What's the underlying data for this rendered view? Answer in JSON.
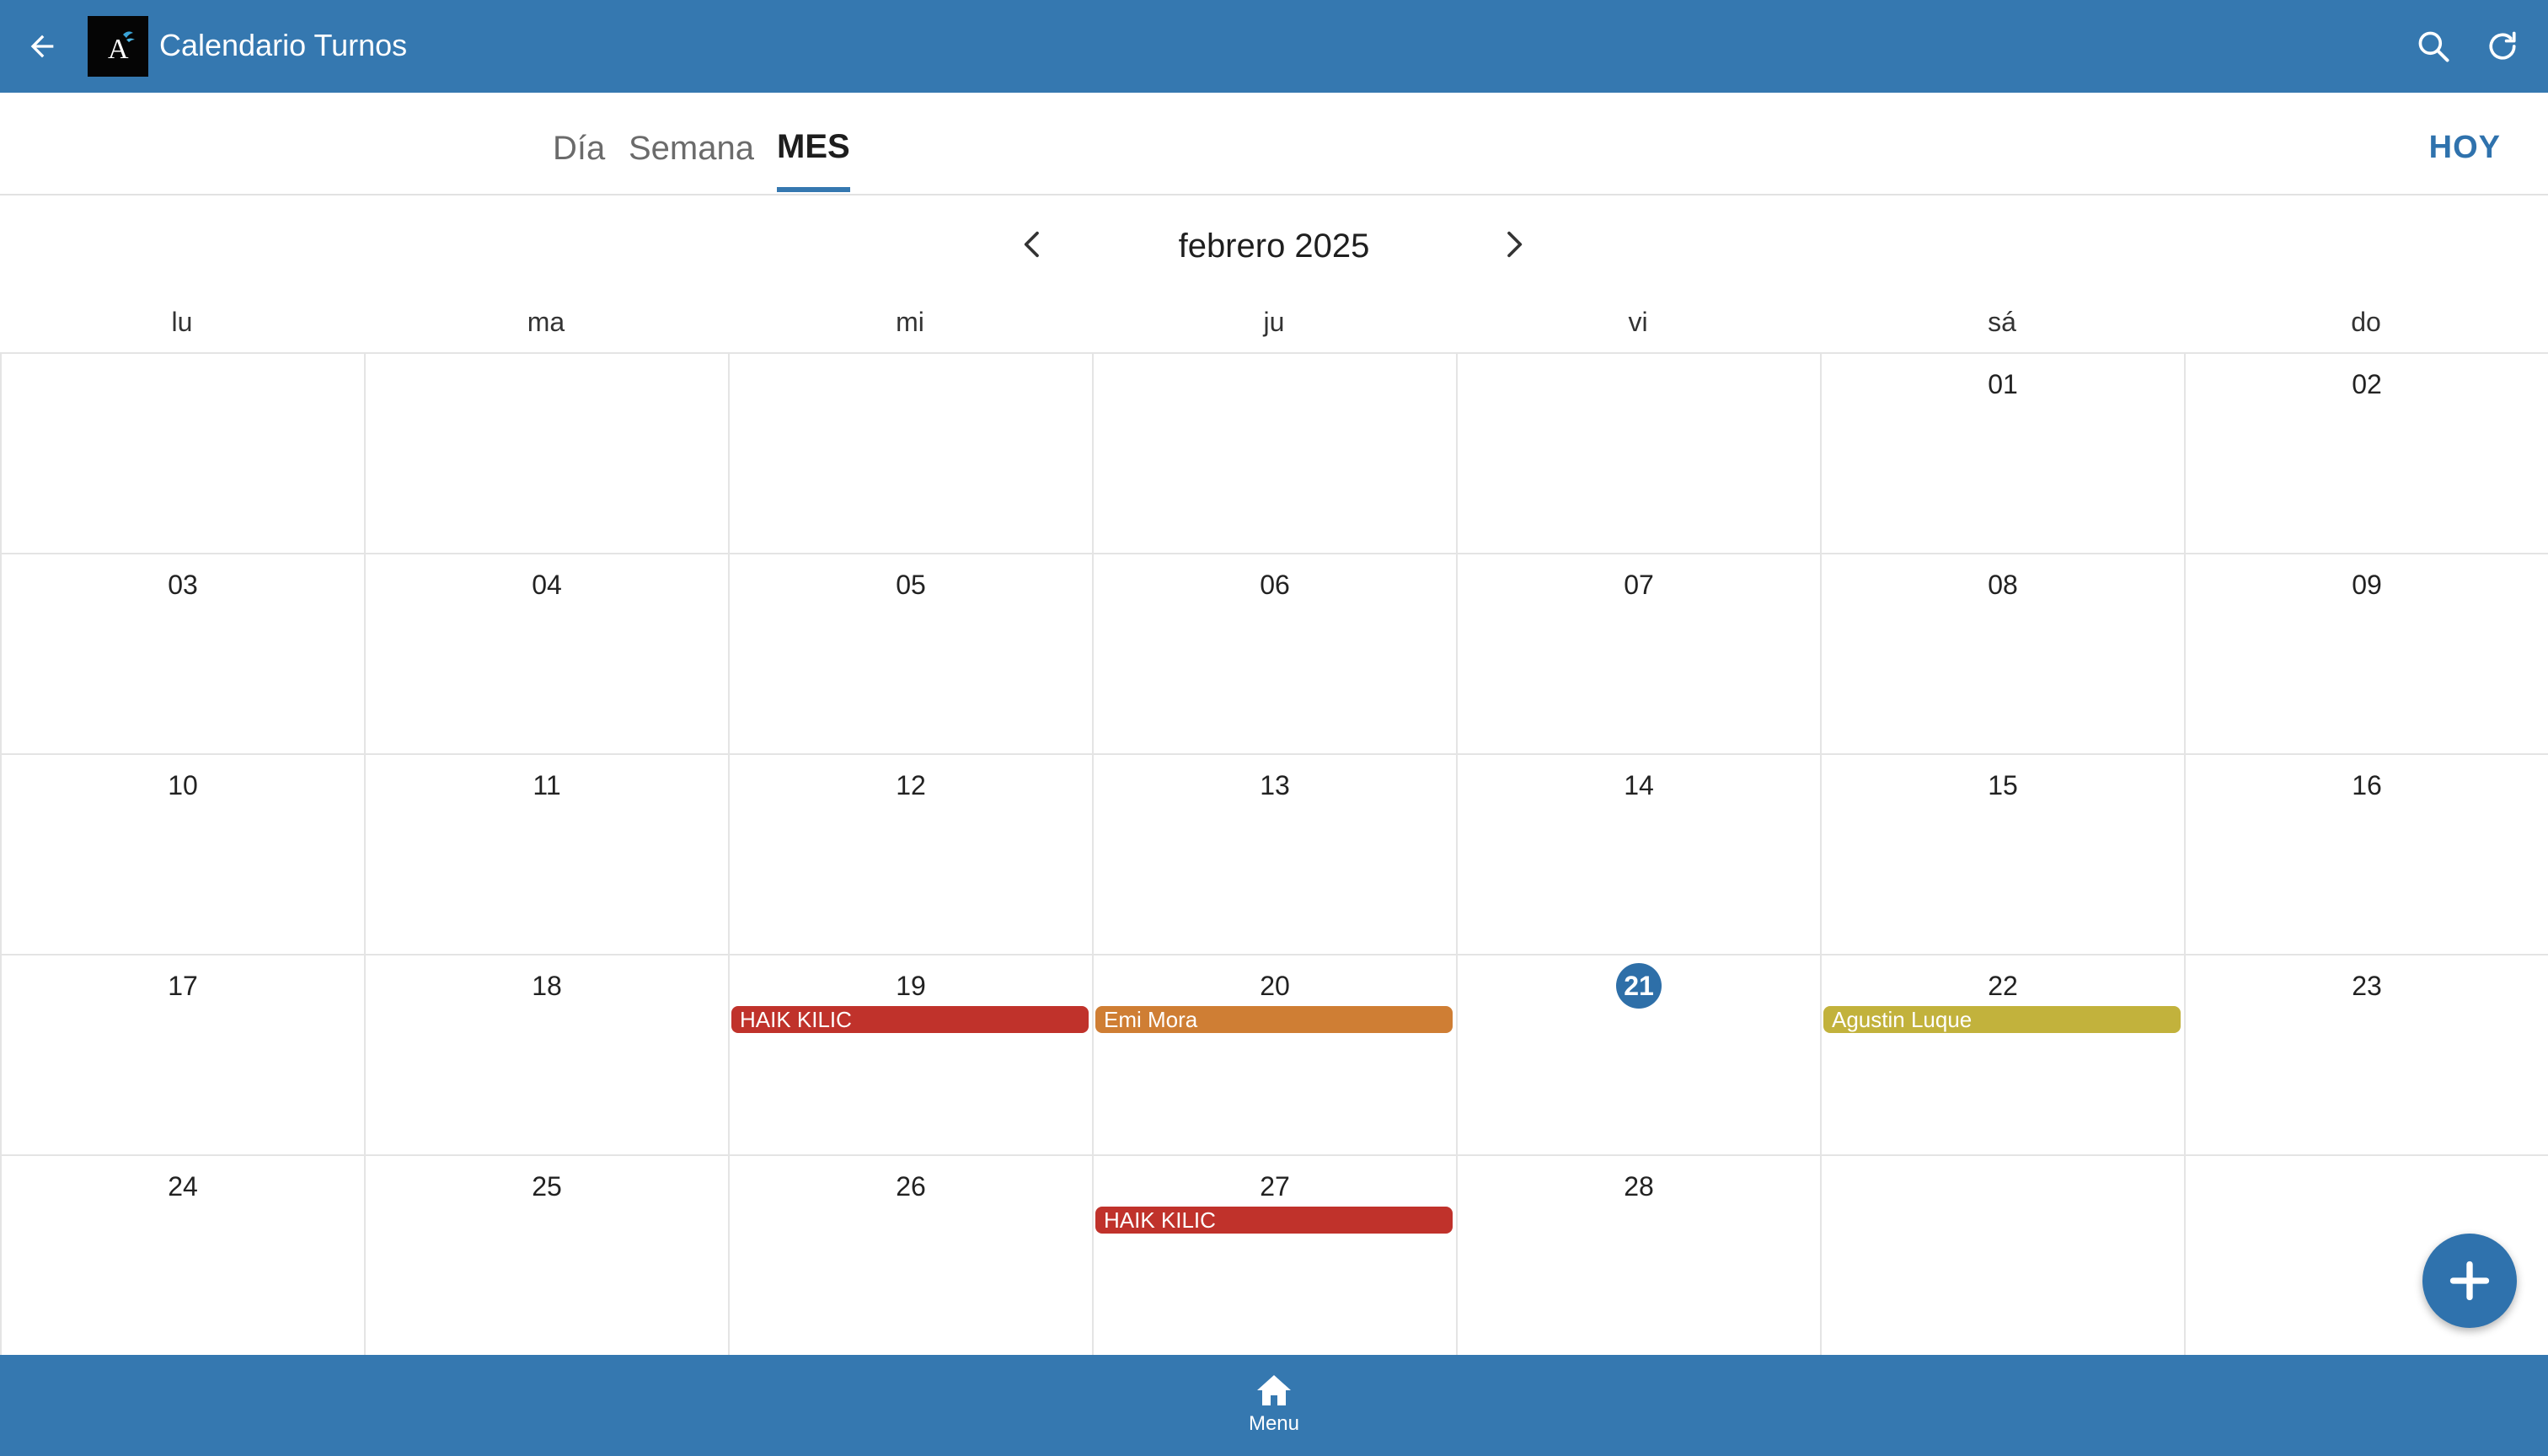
{
  "app": {
    "title": "Calendario Turnos",
    "logo_text": "A"
  },
  "tabs": [
    {
      "label": "Día",
      "active": false
    },
    {
      "label": "Semana",
      "active": false
    },
    {
      "label": "MES",
      "active": true
    }
  ],
  "today_button": "HOY",
  "month_label": "febrero 2025",
  "weekdays": [
    "lu",
    "ma",
    "mi",
    "ju",
    "vi",
    "sá",
    "do"
  ],
  "weeks": [
    [
      "",
      "",
      "",
      "",
      "",
      "01",
      "02"
    ],
    [
      "03",
      "04",
      "05",
      "06",
      "07",
      "08",
      "09"
    ],
    [
      "10",
      "11",
      "12",
      "13",
      "14",
      "15",
      "16"
    ],
    [
      "17",
      "18",
      "19",
      "20",
      "21",
      "22",
      "23"
    ],
    [
      "24",
      "25",
      "26",
      "27",
      "28",
      "",
      ""
    ]
  ],
  "today_day": "21",
  "events": [
    {
      "day": "19",
      "label": "HAIK KILIC",
      "color": "#c0322b"
    },
    {
      "day": "20",
      "label": "Emi Mora",
      "color": "#cf7e34"
    },
    {
      "day": "22",
      "label": "Agustin Luque",
      "color": "#c2b23c"
    },
    {
      "day": "27",
      "label": "HAIK KILIC",
      "color": "#c0322b"
    }
  ],
  "bottom_nav": {
    "menu_label": "Menu",
    "icon": "home-icon"
  },
  "colors": {
    "primary": "#3578b0",
    "accent": "#2f72ad"
  }
}
